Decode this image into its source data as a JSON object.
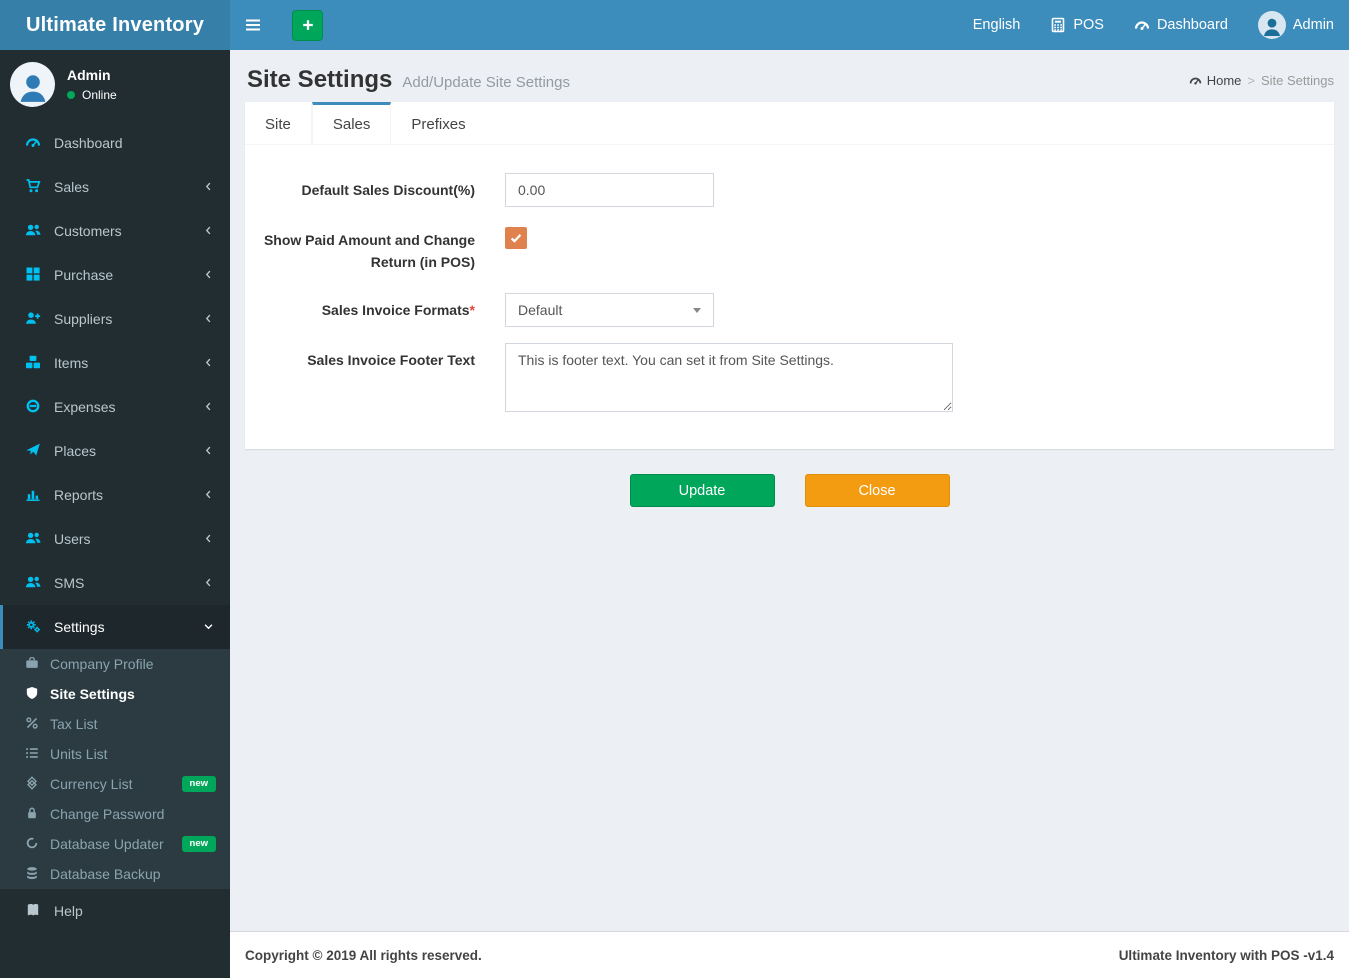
{
  "app": {
    "title": "Ultimate Inventory"
  },
  "topbar": {
    "items": [
      {
        "label": "English"
      },
      {
        "label": "POS",
        "icon": "calculator-icon"
      },
      {
        "label": "Dashboard",
        "icon": "dashboard-icon"
      },
      {
        "label": "Admin",
        "icon": "user-avatar"
      }
    ]
  },
  "user_panel": {
    "name": "Admin",
    "status": "Online"
  },
  "sidebar": {
    "items": [
      {
        "label": "Dashboard",
        "icon": "speedometer-icon"
      },
      {
        "label": "Sales",
        "icon": "cart-icon",
        "arrow": "left"
      },
      {
        "label": "Customers",
        "icon": "users-icon",
        "arrow": "left"
      },
      {
        "label": "Purchase",
        "icon": "grid-icon",
        "arrow": "left"
      },
      {
        "label": "Suppliers",
        "icon": "user-plus-icon",
        "arrow": "left"
      },
      {
        "label": "Items",
        "icon": "cubes-icon",
        "arrow": "left"
      },
      {
        "label": "Expenses",
        "icon": "minus-circle-icon",
        "arrow": "left"
      },
      {
        "label": "Places",
        "icon": "paper-plane-icon",
        "arrow": "left"
      },
      {
        "label": "Reports",
        "icon": "bar-chart-icon",
        "arrow": "left"
      },
      {
        "label": "Users",
        "icon": "users-icon",
        "arrow": "left"
      },
      {
        "label": "SMS",
        "icon": "users-icon",
        "arrow": "left"
      },
      {
        "label": "Settings",
        "icon": "gears-icon",
        "arrow": "down",
        "active": true
      }
    ],
    "settings_submenu": [
      {
        "label": "Company Profile",
        "icon": "briefcase-icon"
      },
      {
        "label": "Site Settings",
        "icon": "shield-icon",
        "active": true
      },
      {
        "label": "Tax List",
        "icon": "percent-icon"
      },
      {
        "label": "Units List",
        "icon": "list-icon"
      },
      {
        "label": "Currency List",
        "icon": "currency-icon",
        "badge": "new"
      },
      {
        "label": "Change Password",
        "icon": "lock-icon"
      },
      {
        "label": "Database Updater",
        "icon": "circle-notch-icon",
        "badge": "new"
      },
      {
        "label": "Database Backup",
        "icon": "database-icon"
      }
    ],
    "help": {
      "label": "Help",
      "icon": "book-icon"
    }
  },
  "page": {
    "title": "Site Settings",
    "subtitle": "Add/Update Site Settings",
    "breadcrumb": {
      "home": "Home",
      "separator": ">",
      "current": "Site Settings"
    }
  },
  "tabs": [
    {
      "label": "Site"
    },
    {
      "label": "Sales",
      "active": true
    },
    {
      "label": "Prefixes"
    }
  ],
  "form": {
    "discount": {
      "label": "Default Sales Discount(%)",
      "value": "0.00"
    },
    "paid_amount": {
      "label": "Show Paid Amount and Change Return (in POS)",
      "checked": true
    },
    "invoice_format": {
      "label": "Sales Invoice Formats",
      "required_mark": "*",
      "value": "Default"
    },
    "footer_text": {
      "label": "Sales Invoice Footer Text",
      "value": "This is footer text. You can set it from Site Settings."
    }
  },
  "actions": {
    "update": "Update",
    "close": "Close"
  },
  "footer": {
    "left": "Copyright © 2019 All rights reserved.",
    "right": "Ultimate Inventory with POS -v1.4"
  },
  "colors": {
    "navbar": "#3c8dbc",
    "logo_bg": "#367fa9",
    "sidebar_bg": "#222d32",
    "submenu_bg": "#2c3b41",
    "icon_accent": "#00c0ef",
    "green": "#00a65a",
    "orange": "#f39c12",
    "checkbox_orange": "#e0824d",
    "content_bg": "#ecf0f5"
  }
}
